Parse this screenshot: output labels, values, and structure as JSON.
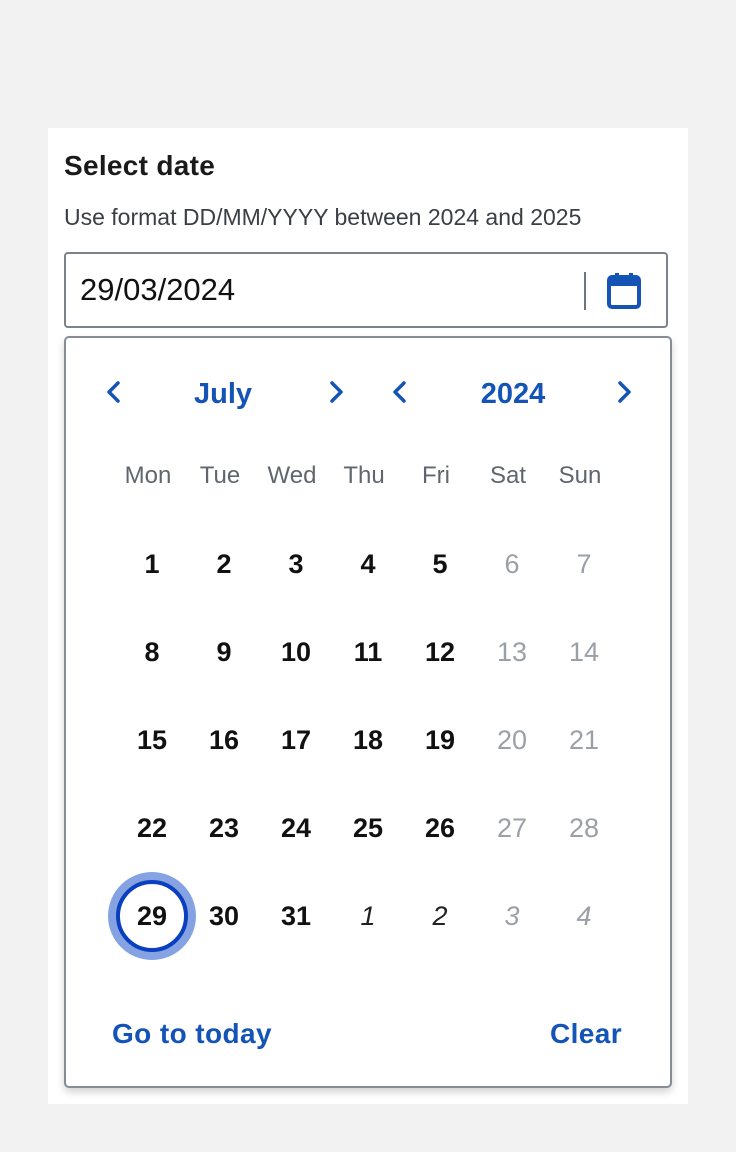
{
  "field": {
    "title": "Select date",
    "hint": "Use format DD/MM/YYYY between 2024 and 2025",
    "value": "29/03/2024"
  },
  "icons": {
    "calendar": "calendar-icon",
    "prev": "chevron-left-icon",
    "next": "chevron-right-icon"
  },
  "calendar": {
    "month": "July",
    "year": "2024",
    "weekdays": [
      "Mon",
      "Tue",
      "Wed",
      "Thu",
      "Fri",
      "Sat",
      "Sun"
    ],
    "weeks": [
      [
        "1",
        "2",
        "3",
        "4",
        "5",
        "6",
        "7"
      ],
      [
        "8",
        "9",
        "10",
        "11",
        "12",
        "13",
        "14"
      ],
      [
        "15",
        "16",
        "17",
        "18",
        "19",
        "20",
        "21"
      ],
      [
        "22",
        "23",
        "24",
        "25",
        "26",
        "27",
        "28"
      ],
      [
        "29",
        "30",
        "31",
        "1",
        "2",
        "3",
        "4"
      ]
    ],
    "go_to_today": "Go to today",
    "clear": "Clear"
  },
  "colors": {
    "accent": "#1554b7",
    "selected_border": "#0b3fbf",
    "selected_halo": "#85a3e3",
    "muted": "#9aa0a6"
  }
}
